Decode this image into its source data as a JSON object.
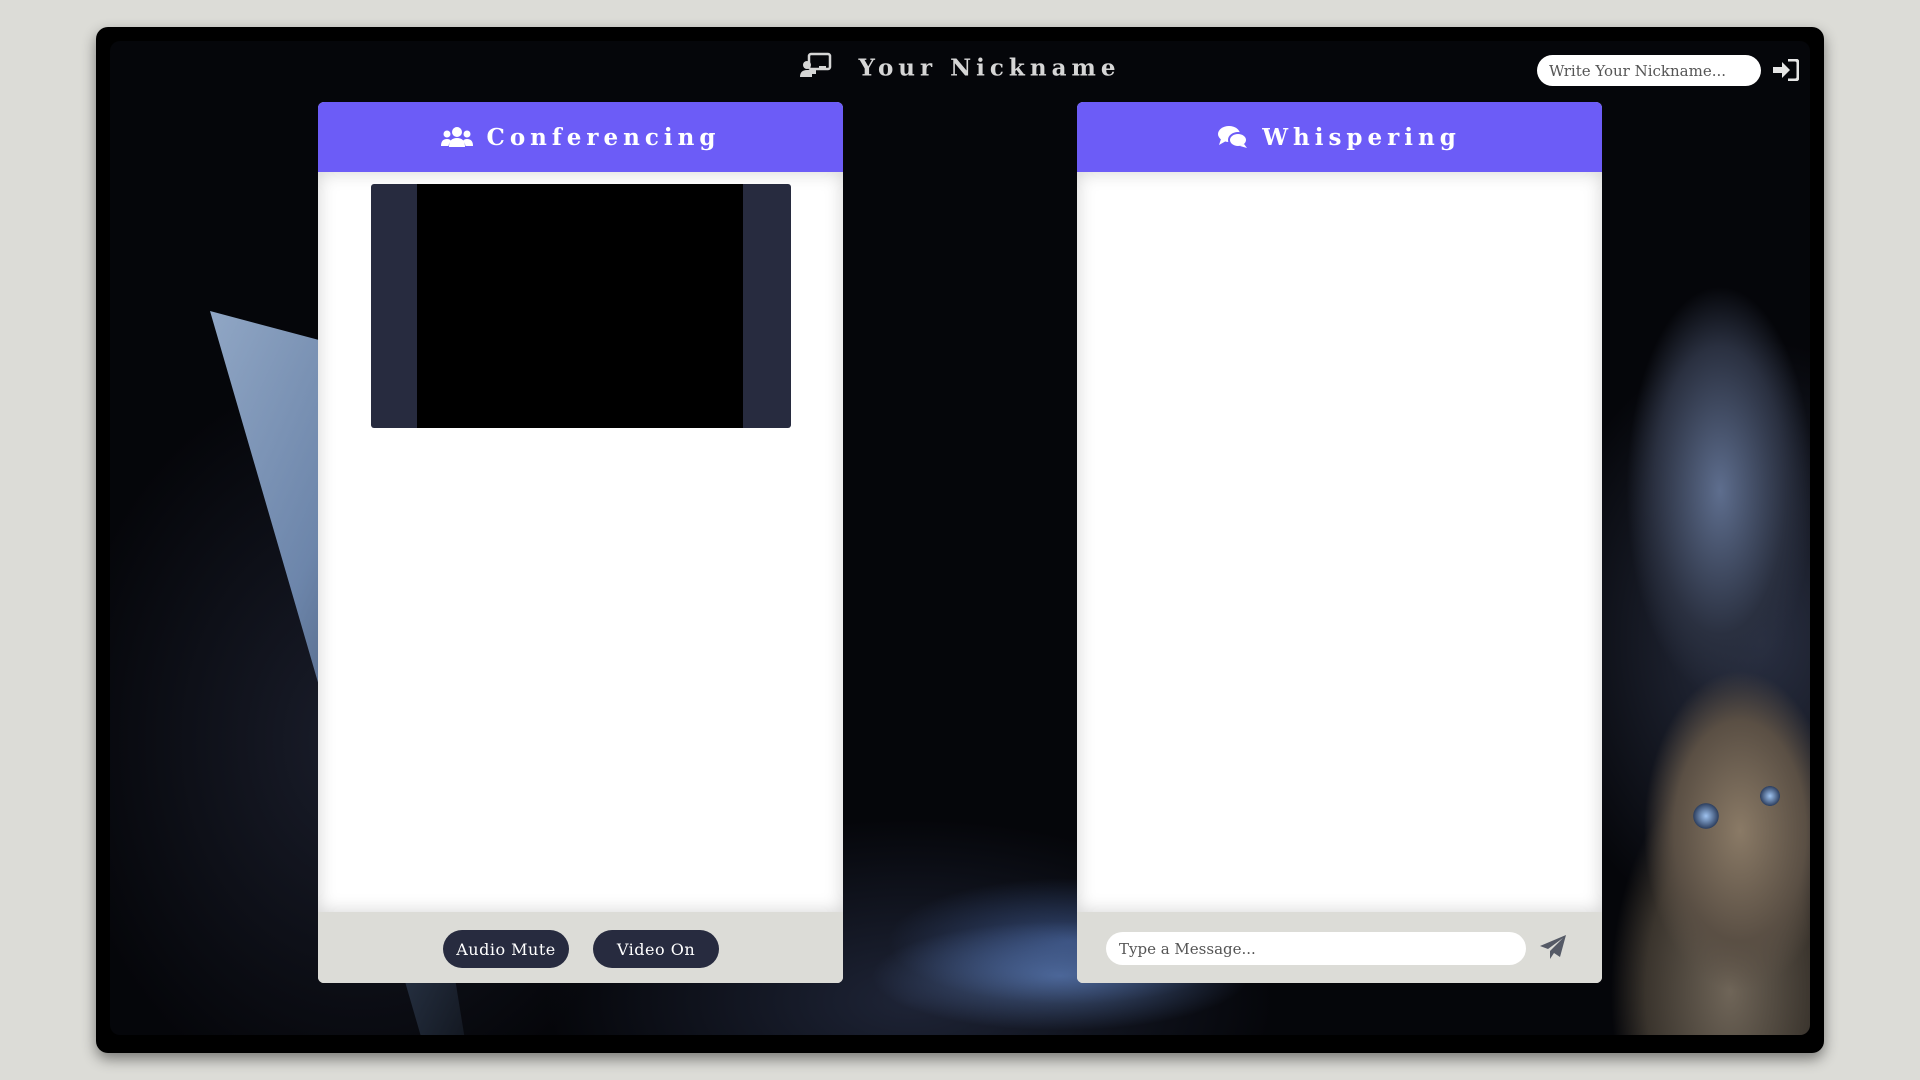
{
  "header": {
    "title": "Your Nickname",
    "title_icon": "chalkboard-user-icon",
    "nickname_placeholder": "Write Your Nickname...",
    "login_icon": "sign-in-icon"
  },
  "conferencing": {
    "title": "Conferencing",
    "icon": "users-icon",
    "audio_button": "Audio Mute",
    "video_button": "Video On"
  },
  "whispering": {
    "title": "Whispering",
    "icon": "comments-icon",
    "message_placeholder": "Type a Message...",
    "send_icon": "paper-plane-icon"
  },
  "colors": {
    "accent": "#6c5cf7",
    "button_dark": "#272b3f",
    "footer_bg": "#dcdcd7",
    "page_bg": "#dcdcd7"
  }
}
